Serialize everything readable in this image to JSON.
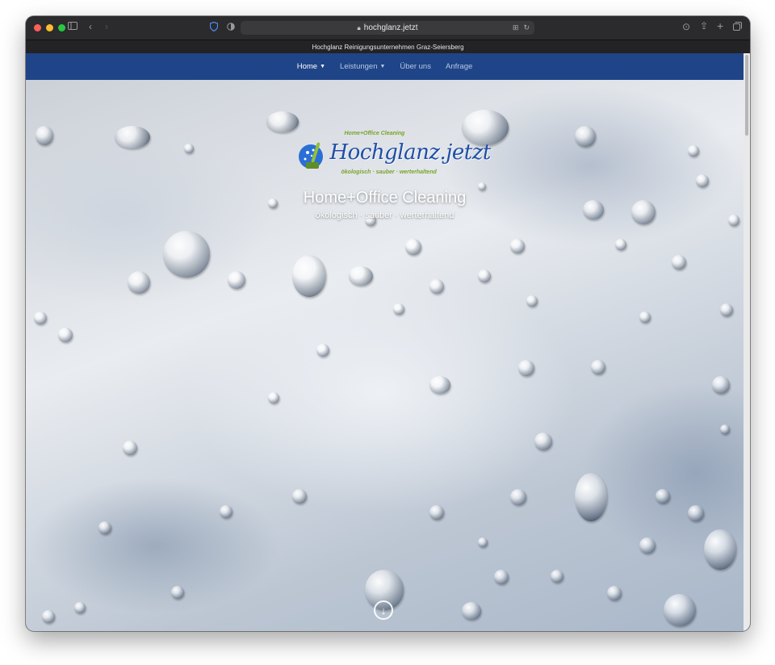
{
  "browser": {
    "url": "hochglanz.jetzt",
    "tab_title": "Hochglanz Reinigungsunternehmen Graz-Seiersberg"
  },
  "nav": {
    "items": [
      {
        "label": "Home",
        "has_dropdown": true,
        "active": true
      },
      {
        "label": "Leistungen",
        "has_dropdown": true,
        "active": false
      },
      {
        "label": "Über uns",
        "has_dropdown": false,
        "active": false
      },
      {
        "label": "Anfrage",
        "has_dropdown": false,
        "active": false
      }
    ]
  },
  "logo": {
    "top_text": "Home+Office Cleaning",
    "name": "Hochglanz.jetzt",
    "sub_text": "ökologisch · sauber · werterhaltend"
  },
  "hero": {
    "title": "Home+Office Cleaning",
    "subtitle": "ökologisch · sauber · werterhaltend"
  },
  "colors": {
    "nav_bg": "#1f4588",
    "logo_blue": "#1f4ea6",
    "logo_green": "#7aa32a"
  },
  "icons": {
    "scroll_down": "arrow-down-circle-icon",
    "lock": "lock-icon"
  }
}
